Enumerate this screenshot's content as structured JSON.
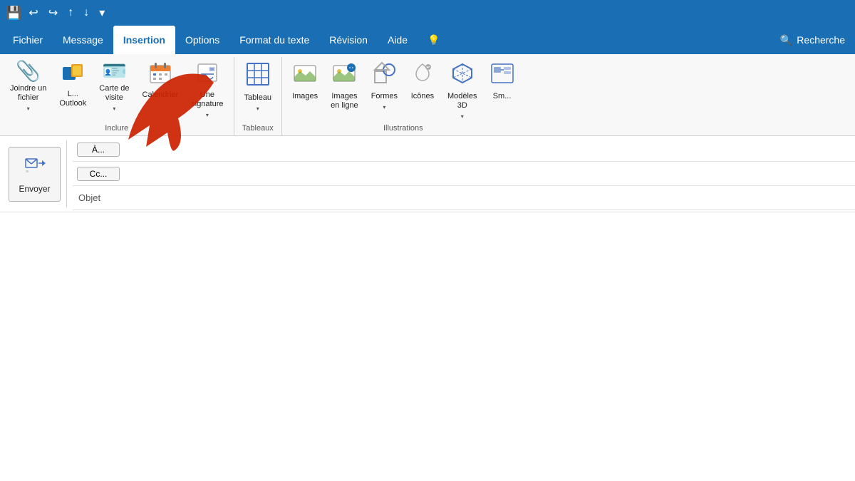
{
  "titlebar": {
    "save_icon": "💾",
    "undo_icon": "↩",
    "redo_icon": "↪",
    "up_icon": "↑",
    "down_icon": "↓",
    "more_icon": "▾"
  },
  "menubar": {
    "items": [
      {
        "id": "fichier",
        "label": "Fichier",
        "active": false
      },
      {
        "id": "message",
        "label": "Message",
        "active": false
      },
      {
        "id": "insertion",
        "label": "Insertion",
        "active": true
      },
      {
        "id": "options",
        "label": "Options",
        "active": false
      },
      {
        "id": "format",
        "label": "Format du texte",
        "active": false
      },
      {
        "id": "revision",
        "label": "Révision",
        "active": false
      },
      {
        "id": "aide",
        "label": "Aide",
        "active": false
      },
      {
        "id": "lightbulb",
        "label": "💡",
        "active": false
      }
    ],
    "search_placeholder": "Recherche"
  },
  "ribbon": {
    "groups": [
      {
        "id": "inclure",
        "label": "Inclure",
        "buttons": [
          {
            "id": "joindre",
            "label": "Joindre un\nfichier",
            "icon": "📎",
            "dropdown": true
          },
          {
            "id": "outlook",
            "label": "L...\nOutlook",
            "icon": "📋",
            "dropdown": false
          },
          {
            "id": "carte",
            "label": "Carte de\nvisite",
            "icon": "🪪",
            "dropdown": true
          },
          {
            "id": "calendrier",
            "label": "Calendrier",
            "icon": "📅",
            "dropdown": false
          },
          {
            "id": "signature",
            "label": "Une\nsignature",
            "icon": "✍",
            "dropdown": true
          }
        ]
      },
      {
        "id": "tableaux",
        "label": "Tableaux",
        "buttons": [
          {
            "id": "tableau",
            "label": "Tableau",
            "icon": "⊞",
            "dropdown": true
          }
        ]
      },
      {
        "id": "illustrations",
        "label": "Illustrations",
        "buttons": [
          {
            "id": "images",
            "label": "Images",
            "icon": "🖼",
            "dropdown": false
          },
          {
            "id": "images-enligne",
            "label": "Images\nen ligne",
            "icon": "🌐",
            "dropdown": false
          },
          {
            "id": "formes",
            "label": "Formes",
            "icon": "◇",
            "dropdown": true
          },
          {
            "id": "icones",
            "label": "Icônes",
            "icon": "🕊",
            "dropdown": false
          },
          {
            "id": "modeles3d",
            "label": "Modèles\n3D",
            "icon": "⬡",
            "dropdown": true
          },
          {
            "id": "smartart",
            "label": "Sm...",
            "icon": "🔷",
            "dropdown": false
          }
        ]
      }
    ]
  },
  "compose": {
    "send_label": "Envoyer",
    "to_label": "À...",
    "cc_label": "Cc...",
    "subject_label": "Objet",
    "to_value": "",
    "cc_value": "",
    "subject_value": ""
  }
}
